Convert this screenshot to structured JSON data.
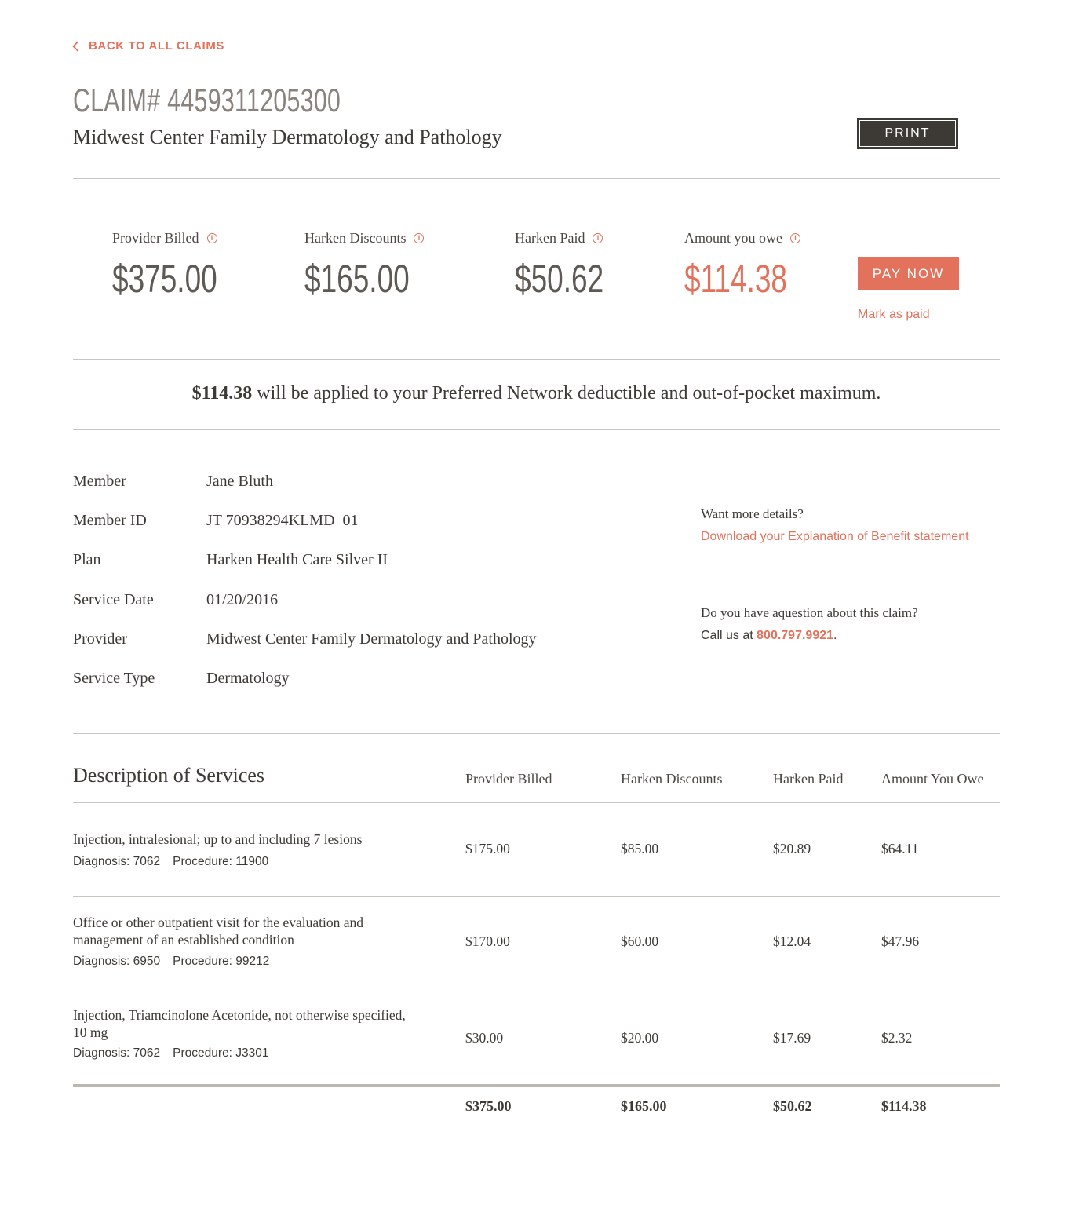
{
  "nav": {
    "back_label": "BACK TO ALL CLAIMS"
  },
  "header": {
    "claim_title": "CLAIM# 4459311205300",
    "provider_name": "Midwest Center Family Dermatology and Pathology",
    "print_label": "PRINT"
  },
  "summary": {
    "items": [
      {
        "label": "Provider Billed",
        "value": "$375.00"
      },
      {
        "label": "Harken Discounts",
        "value": "$165.00"
      },
      {
        "label": "Harken Paid",
        "value": "$50.62"
      },
      {
        "label": "Amount you owe",
        "value": "$114.38"
      }
    ],
    "pay_label": "PAY NOW",
    "mark_paid_label": "Mark as paid",
    "info_icon_glyph": "i"
  },
  "deductible_note": {
    "amount": "$114.38",
    "text": " will be applied to your Preferred Network deductible and out-of-pocket maximum."
  },
  "member_details": [
    {
      "label": "Member",
      "value": "Jane Bluth"
    },
    {
      "label": "Member ID",
      "value": "JT 70938294KLMD  01"
    },
    {
      "label": "Plan",
      "value": "Harken Health Care Silver II"
    },
    {
      "label": "Service Date",
      "value": "01/20/2016"
    },
    {
      "label": "Provider",
      "value": "Midwest Center Family Dermatology and Pathology"
    },
    {
      "label": "Service Type",
      "value": "Dermatology"
    }
  ],
  "help": {
    "more_details_question": "Want more details?",
    "eob_link": "Download your Explanation of Benefit statement",
    "claim_question": "Do you have aquestion about this claim?",
    "call_prefix": "Call us at ",
    "phone": "800.797.9921",
    "call_suffix": "."
  },
  "services": {
    "title": "Description of Services",
    "columns": [
      "Provider Billed",
      "Harken Discounts",
      "Harken Paid",
      "Amount You Owe"
    ],
    "rows": [
      {
        "description": "Injection, intralesional; up to and including 7 lesions",
        "diagnosis": "Diagnosis: 7062",
        "procedure": "Procedure: 11900",
        "billed": "$175.00",
        "discounts": "$85.00",
        "paid": "$20.89",
        "owe": "$64.11"
      },
      {
        "description": "Office or other outpatient visit for the evaluation and management of an established condition",
        "diagnosis": "Diagnosis: 6950",
        "procedure": "Procedure: 99212",
        "billed": "$170.00",
        "discounts": "$60.00",
        "paid": "$12.04",
        "owe": "$47.96"
      },
      {
        "description": "Injection, Triamcinolone Acetonide, not otherwise specified, 10 mg",
        "diagnosis": "Diagnosis: 7062",
        "procedure": "Procedure: J3301",
        "billed": "$30.00",
        "discounts": "$20.00",
        "paid": "$17.69",
        "owe": "$2.32"
      }
    ],
    "totals": {
      "billed": "$375.00",
      "discounts": "$165.00",
      "paid": "$50.62",
      "owe": "$114.38"
    }
  },
  "colors": {
    "accent": "#e2725b",
    "dark": "#3d3935",
    "muted": "#8a837d",
    "rule": "#c9c5c1"
  }
}
